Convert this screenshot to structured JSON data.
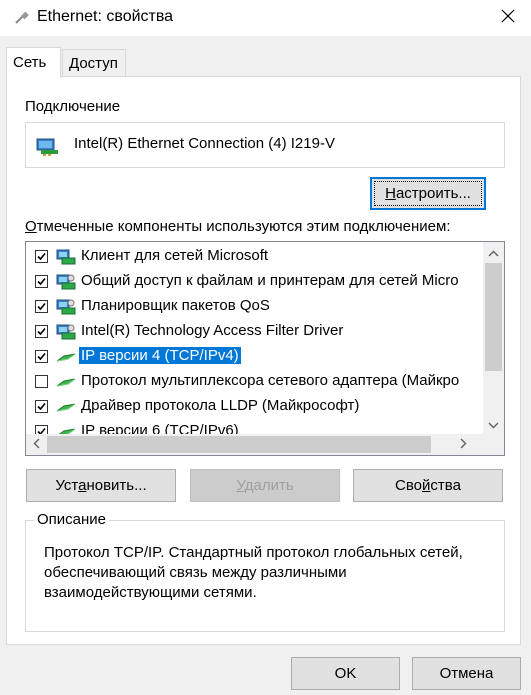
{
  "window": {
    "title": "Ethernet: свойства",
    "icon": "network-cable-icon",
    "close_icon": "close-icon"
  },
  "tabs": [
    {
      "label": "Сеть",
      "active": true
    },
    {
      "label": "Доступ",
      "active": false
    }
  ],
  "connection": {
    "label": "Подключение",
    "adapter_name": "Intel(R) Ethernet Connection (4) I219-V",
    "configure_button_prefix": "",
    "configure_button_ul": "Н",
    "configure_button_rest": "астроить..."
  },
  "components": {
    "label_ul": "О",
    "label_rest": "тмеченные компоненты используются этим подключением:",
    "items": [
      {
        "label": "Клиент для сетей Microsoft",
        "checked": true,
        "icon": "client-network-icon",
        "selected": false
      },
      {
        "label": "Общий доступ к файлам и принтерам для сетей Micro",
        "checked": true,
        "icon": "service-network-icon",
        "selected": false
      },
      {
        "label": "Планировщик пакетов QoS",
        "checked": true,
        "icon": "service-network-icon",
        "selected": false
      },
      {
        "label": "Intel(R) Technology Access Filter Driver",
        "checked": true,
        "icon": "service-network-icon",
        "selected": false
      },
      {
        "label": "IP версии 4 (TCP/IPv4)",
        "checked": true,
        "icon": "protocol-icon",
        "selected": true
      },
      {
        "label": "Протокол мультиплексора сетевого адаптера (Майкро",
        "checked": false,
        "icon": "protocol-icon",
        "selected": false
      },
      {
        "label": "Драйвер протокола LLDP (Майкрософт)",
        "checked": true,
        "icon": "protocol-icon",
        "selected": false
      },
      {
        "label": "IP версии 6 (TCP/IPv6)",
        "checked": true,
        "icon": "protocol-icon",
        "selected": false
      }
    ]
  },
  "buttons": {
    "install_prefix": "Уст",
    "install_ul": "а",
    "install_rest": "новить...",
    "remove_ul": "У",
    "remove_rest": "далить",
    "properties_prefix": "Сво",
    "properties_ul": "й",
    "properties_rest": "ства"
  },
  "description": {
    "legend": "Описание",
    "text": "Протокол TCP/IP. Стандартный протокол глобальных сетей, обеспечивающий связь между различными взаимодействующими сетями."
  },
  "footer": {
    "ok": "OK",
    "cancel": "Отмена"
  },
  "colors": {
    "selection": "#0078d7",
    "dialog_bg": "#f0f0f0",
    "button_bg": "#e1e1e1"
  }
}
